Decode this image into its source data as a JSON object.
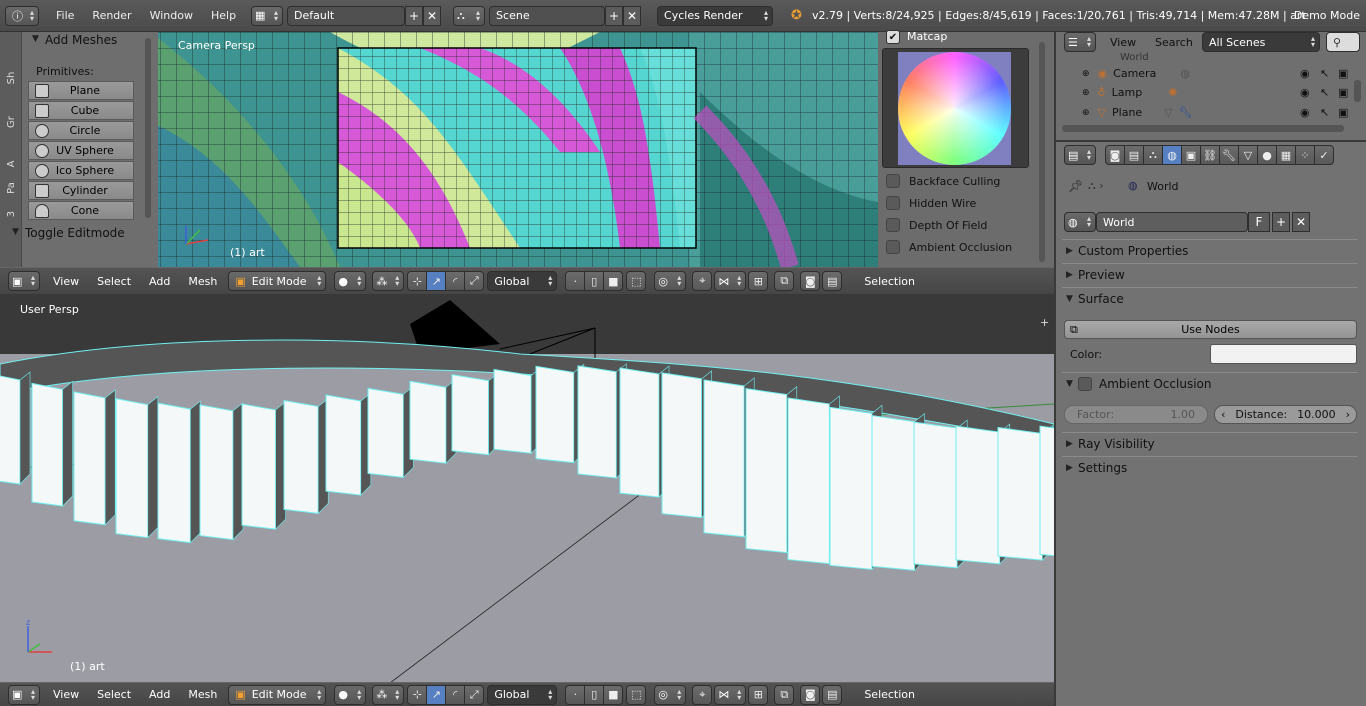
{
  "topbar": {
    "menus": [
      "File",
      "Render",
      "Window",
      "Help"
    ],
    "screen_layout": "Default",
    "scene": "Scene",
    "engine": "Cycles Render",
    "stats": "v2.79 | Verts:8/24,925 | Edges:8/45,619 | Faces:1/20,761 | Tris:49,714 | Mem:47.28M | art",
    "demo_mode": "Demo Mode"
  },
  "tool_shelf": {
    "tabs": [
      "Sh",
      "Gr",
      "A",
      "Pa",
      "3"
    ],
    "section": "Add Meshes",
    "primitives_label": "Primitives:",
    "primitives": [
      "Plane",
      "Cube",
      "Circle",
      "UV Sphere",
      "Ico Sphere",
      "Cylinder",
      "Cone"
    ],
    "toggle": "Toggle Editmode"
  },
  "top_view": {
    "label": "Camera Persp",
    "object_label": "(1) art"
  },
  "shading_panel": {
    "matcap_label": "Matcap",
    "options": [
      "Backface Culling",
      "Hidden Wire",
      "Depth Of Field",
      "Ambient Occlusion"
    ]
  },
  "view_header": {
    "menus": [
      "View",
      "Select",
      "Add",
      "Mesh"
    ],
    "mode": "Edit Mode",
    "orientation": "Global",
    "selection": "Selection"
  },
  "bottom_view": {
    "label": "User Persp",
    "object_label": "(1) art"
  },
  "outliner": {
    "menus": [
      "View",
      "Search"
    ],
    "filter": "All Scenes",
    "partial_row": "World",
    "rows": [
      "Camera",
      "Lamp",
      "Plane"
    ]
  },
  "properties": {
    "breadcrumb": "World",
    "world_name": "World",
    "fake_user": "F",
    "sections": {
      "custom": "Custom Properties",
      "preview": "Preview",
      "surface": "Surface",
      "ao": "Ambient Occlusion",
      "ray": "Ray Visibility",
      "settings": "Settings"
    },
    "use_nodes": "Use Nodes",
    "color_label": "Color:",
    "factor_label": "Factor:",
    "factor_value": "1.00",
    "distance_label": "Distance:",
    "distance_value": "10.000"
  },
  "colors": {
    "accent": "#5680c2",
    "wire": "#6ff0f0",
    "magenta": "#d05ad8",
    "teal": "#2e8e8e"
  }
}
